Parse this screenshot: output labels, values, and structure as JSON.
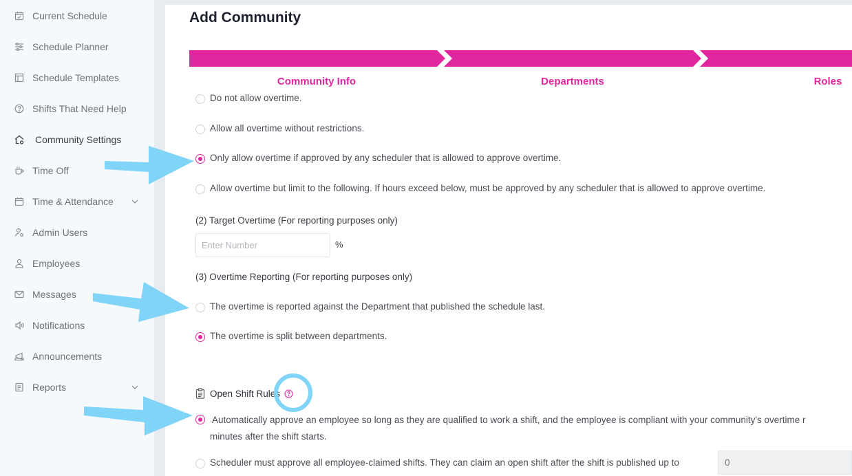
{
  "sidebar": {
    "items": [
      {
        "label": "Current Schedule",
        "icon": "calendar-check-icon"
      },
      {
        "label": "Schedule Planner",
        "icon": "sliders-icon"
      },
      {
        "label": "Schedule Templates",
        "icon": "template-icon"
      },
      {
        "label": "Shifts That Need Help",
        "icon": "help-circle-icon"
      },
      {
        "label": "Community Settings",
        "icon": "house-settings-icon"
      },
      {
        "label": "Time Off",
        "icon": "coffee-cup-icon"
      },
      {
        "label": "Time & Attendance",
        "icon": "calendar-icon"
      },
      {
        "label": "Admin Users",
        "icon": "user-cog-icon"
      },
      {
        "label": "Employees",
        "icon": "user-icon"
      },
      {
        "label": "Messages",
        "icon": "envelope-icon"
      },
      {
        "label": "Notifications",
        "icon": "speaker-icon"
      },
      {
        "label": "Announcements",
        "icon": "megaphone-icon"
      },
      {
        "label": "Reports",
        "icon": "report-icon"
      }
    ]
  },
  "page": {
    "title": "Add Community"
  },
  "steps": [
    "Community Info",
    "Departments",
    "Roles"
  ],
  "overtime": {
    "options": [
      {
        "label": "Do not allow overtime.",
        "selected": false
      },
      {
        "label": "Allow all overtime without restrictions.",
        "selected": false
      },
      {
        "label": "Only allow overtime if approved by any scheduler that is allowed to approve overtime.",
        "selected": true
      },
      {
        "label": "Allow overtime but limit to the following. If hours exceed below, must be approved by any scheduler that is allowed to approve overtime.",
        "selected": false
      }
    ]
  },
  "target_overtime": {
    "label": "(2) Target Overtime (For reporting purposes only)",
    "placeholder": "Enter Number",
    "unit": "%"
  },
  "overtime_reporting": {
    "label": "(3) Overtime Reporting (For reporting purposes only)",
    "options": [
      {
        "label": "The overtime is reported against the Department that published the schedule last.",
        "selected": false
      },
      {
        "label": "The overtime is split between departments.",
        "selected": true
      }
    ]
  },
  "open_shift": {
    "title": "Open Shift Rules",
    "option1_line1": "Automatically approve an employee so long as they are qualified to work a shift, and the employee is compliant with your community's overtime r",
    "option1_line2": "minutes after the shift starts.",
    "option2": "Scheduler must approve all employee-claimed shifts. They can claim an open shift after the shift is published up to",
    "option2_value": "0"
  },
  "colors": {
    "accent": "#e0279f",
    "arrow": "#7fd4f8"
  }
}
